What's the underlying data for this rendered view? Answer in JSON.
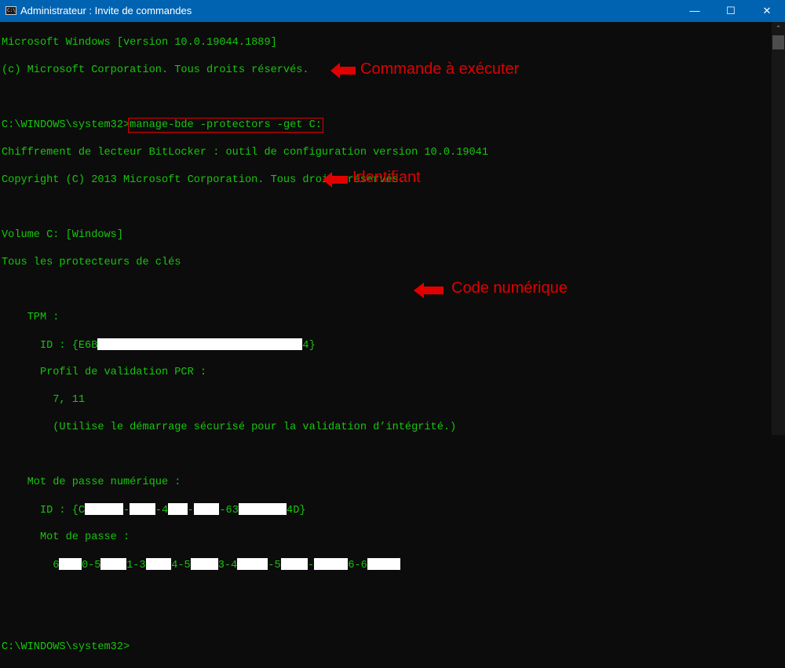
{
  "window": {
    "title": "Administrateur : Invite de commandes",
    "icon_label": "C:\\",
    "minimize": "—",
    "maximize": "☐",
    "close": "✕"
  },
  "console": {
    "lines": {
      "l1": "Microsoft Windows [version 10.0.19044.1889]",
      "l2": "(c) Microsoft Corporation. Tous droits réservés.",
      "prompt1": "C:\\WINDOWS\\system32>",
      "command": "manage-bde -protectors -get C:",
      "l4": "Chiffrement de lecteur BitLocker : outil de configuration version 10.0.19041",
      "l5": "Copyright (C) 2013 Microsoft Corporation. Tous droits réservés.",
      "l6": "Volume C: [Windows]",
      "l7": "Tous les protecteurs de clés",
      "tpm": "    TPM :",
      "tpm_id_a": "      ID : {E6B",
      "tpm_id_b": "4}",
      "pcr_label": "      Profil de validation PCR :",
      "pcr_values": "        7, 11",
      "pcr_note": "        (Utilise le démarrage sécurisé pour la validation d’intégrité.)",
      "num_label": "    Mot de passe numérique :",
      "num_id": [
        "      ID : {C",
        "-",
        "-4",
        "-",
        "-63",
        "4D}"
      ],
      "pwd_label": "      Mot de passe :",
      "pwd": [
        "        6",
        "0-5",
        "1-3",
        "4-5",
        "3-4",
        "-5",
        "-",
        "6-6"
      ],
      "prompt2": "C:\\WINDOWS\\system32>"
    }
  },
  "annotations": {
    "command": "Commande à exécuter",
    "identifier": "Identifiant",
    "code": "Code numérique",
    "color": "#e00000"
  },
  "scrollbar": {
    "up": "⌃"
  }
}
